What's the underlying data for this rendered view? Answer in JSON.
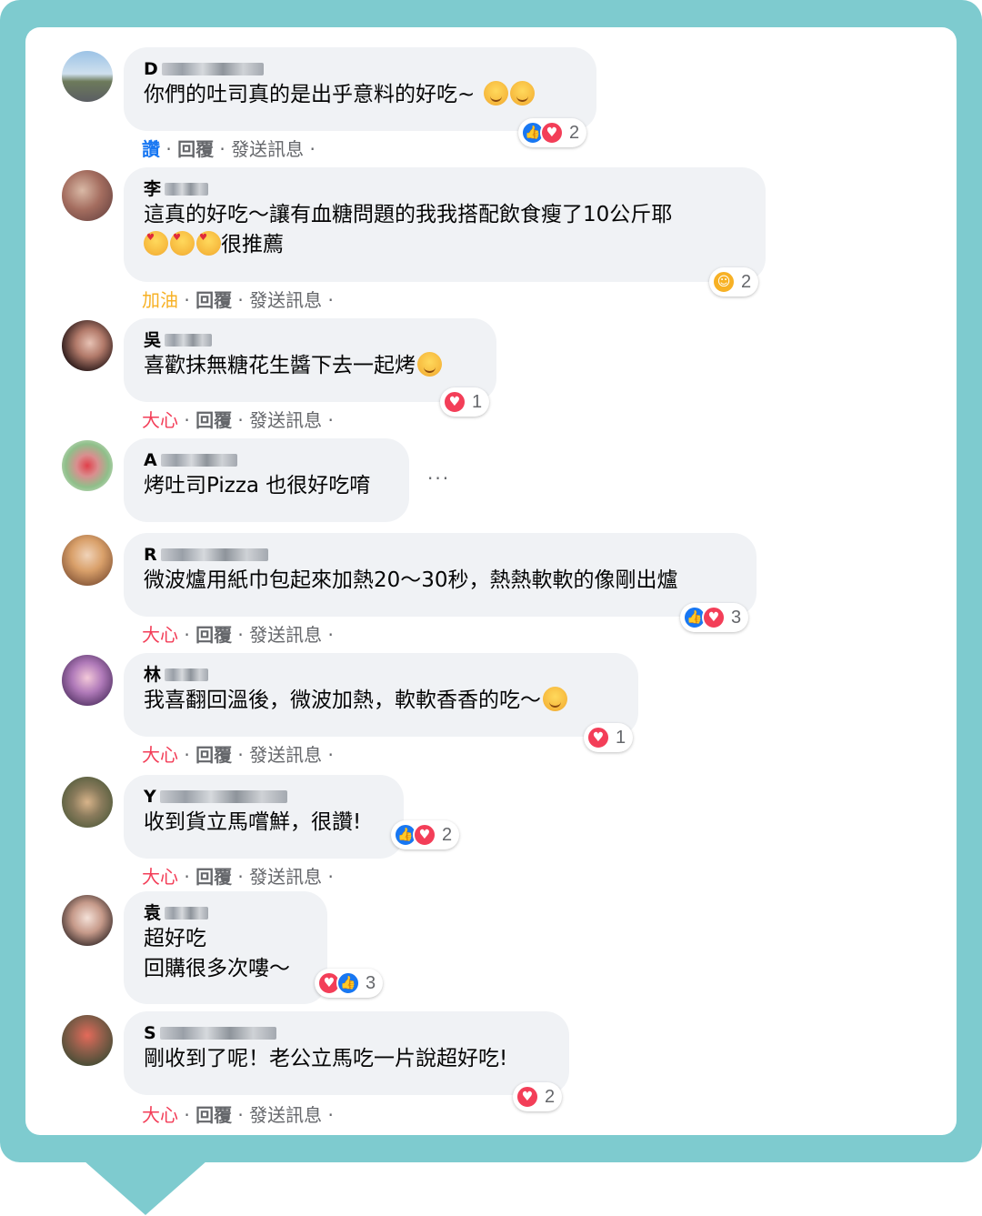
{
  "comments": [
    {
      "name_initial": "D",
      "text_lines": [
        "你們的吐司真的是出乎意料的好吃~"
      ],
      "emojis": [
        "smile",
        "smile"
      ],
      "reactions": [
        "like",
        "love"
      ],
      "reaction_count": "2",
      "action1": "讚",
      "action1_color": "#1877f2",
      "reply": "回覆",
      "message": "發送訊息"
    },
    {
      "name_initial": "李",
      "text_lines": [
        "這真的好吃～讓有血糖問題的我我搭配飲食瘦了10公斤耶",
        "很推薦"
      ],
      "emojis": [
        "love-face",
        "love-face",
        "love-face"
      ],
      "reactions": [
        "care"
      ],
      "reaction_count": "2",
      "action1": "加油",
      "action1_color": "#f7b125",
      "reply": "回覆",
      "message": "發送訊息"
    },
    {
      "name_initial": "吳",
      "text_lines": [
        "喜歡抹無糖花生醬下去一起烤"
      ],
      "emojis": [
        "smile"
      ],
      "reactions": [
        "love"
      ],
      "reaction_count": "1",
      "action1": "大心",
      "action1_color": "#f33e58",
      "reply": "回覆",
      "message": "發送訊息"
    },
    {
      "name_initial": "A",
      "text_lines": [
        "烤吐司Pizza 也很好吃唷"
      ],
      "emojis": [],
      "reactions": [],
      "reaction_count": "",
      "action1": "",
      "action1_color": "",
      "reply": "",
      "message": "",
      "more": "···"
    },
    {
      "name_initial": "R",
      "text_lines": [
        "微波爐用紙巾包起來加熱20～30秒，熱熱軟軟的像剛出爐"
      ],
      "emojis": [],
      "reactions": [
        "like",
        "love"
      ],
      "reaction_count": "3",
      "action1": "大心",
      "action1_color": "#f33e58",
      "reply": "回覆",
      "message": "發送訊息"
    },
    {
      "name_initial": "林",
      "text_lines": [
        "我喜翻回溫後，微波加熱，軟軟香香的吃～"
      ],
      "emojis": [
        "smile"
      ],
      "reactions": [
        "love"
      ],
      "reaction_count": "1",
      "action1": "大心",
      "action1_color": "#f33e58",
      "reply": "回覆",
      "message": "發送訊息"
    },
    {
      "name_initial": "Y",
      "text_lines": [
        "收到貨立馬嚐鮮，很讚!"
      ],
      "emojis": [],
      "reactions": [
        "like",
        "love"
      ],
      "reaction_count": "2",
      "action1": "大心",
      "action1_color": "#f33e58",
      "reply": "回覆",
      "message": "發送訊息"
    },
    {
      "name_initial": "袁",
      "text_lines": [
        "超好吃",
        "回購很多次嘍～"
      ],
      "emojis": [],
      "reactions": [
        "love",
        "like"
      ],
      "reaction_count": "3",
      "action1": "",
      "action1_color": "",
      "reply": "",
      "message": ""
    },
    {
      "name_initial": "S",
      "text_lines": [
        "剛收到了呢！老公立馬吃一片說超好吃!"
      ],
      "emojis": [],
      "reactions": [
        "love"
      ],
      "reaction_count": "2",
      "action1": "大心",
      "action1_color": "#f33e58",
      "reply": "回覆",
      "message": "發送訊息"
    }
  ],
  "colors": {
    "frame": "#7ecbcf",
    "bubble": "#f0f2f5",
    "like": "#1877f2",
    "love": "#f33e58",
    "care": "#f7b125"
  }
}
